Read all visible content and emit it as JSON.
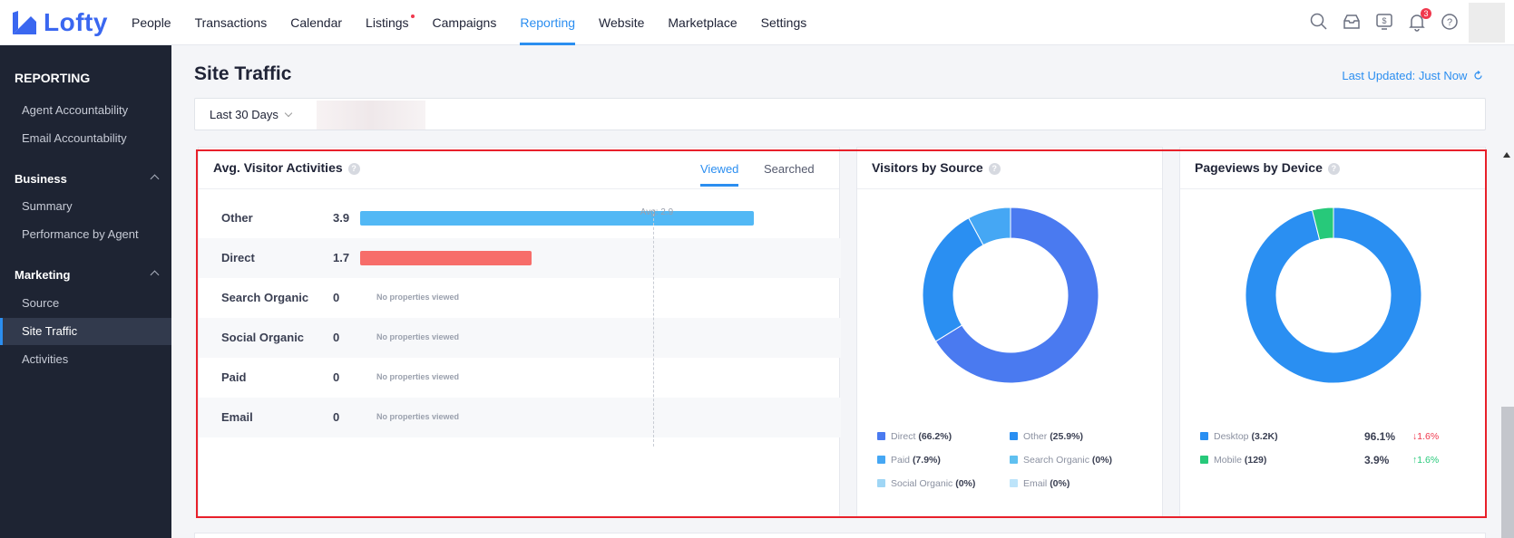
{
  "app": {
    "logo_text": "Lofty"
  },
  "nav": {
    "items": [
      "People",
      "Transactions",
      "Calendar",
      "Listings",
      "Campaigns",
      "Reporting",
      "Website",
      "Marketplace",
      "Settings"
    ],
    "active": "Reporting",
    "dot_on": "Listings",
    "notification_count": "3"
  },
  "sidebar": {
    "header": "REPORTING",
    "top_items": [
      "Agent Accountability",
      "Email Accountability"
    ],
    "business": {
      "label": "Business",
      "items": [
        "Summary",
        "Performance by Agent"
      ]
    },
    "marketing": {
      "label": "Marketing",
      "items": [
        "Source",
        "Site Traffic",
        "Activities"
      ]
    },
    "active": "Site Traffic"
  },
  "page": {
    "title": "Site Traffic",
    "last_updated": "Last Updated: Just Now",
    "date_range": "Last 30 Days"
  },
  "activities": {
    "title": "Avg. Visitor Activities",
    "tabs": [
      "Viewed",
      "Searched"
    ],
    "active_tab": "Viewed",
    "avg_label": "Avg: 2.9",
    "avg": 2.9,
    "max": 3.9,
    "empty_text": "No properties viewed",
    "rows": [
      {
        "label": "Other",
        "value": "3.9",
        "num": 3.9,
        "color": "#52b8f5"
      },
      {
        "label": "Direct",
        "value": "1.7",
        "num": 1.7,
        "color": "#f76d6a"
      },
      {
        "label": "Search Organic",
        "value": "0",
        "num": 0,
        "color": ""
      },
      {
        "label": "Social Organic",
        "value": "0",
        "num": 0,
        "color": ""
      },
      {
        "label": "Paid",
        "value": "0",
        "num": 0,
        "color": ""
      },
      {
        "label": "Email",
        "value": "0",
        "num": 0,
        "color": ""
      }
    ]
  },
  "sources": {
    "title": "Visitors by Source",
    "legend": [
      {
        "name": "Direct",
        "pct": "(66.2%)",
        "value": 66.2,
        "color": "#4a7af0"
      },
      {
        "name": "Other",
        "pct": "(25.9%)",
        "value": 25.9,
        "color": "#2a8ff2"
      },
      {
        "name": "Paid",
        "pct": "(7.9%)",
        "value": 7.9,
        "color": "#45a7f4"
      },
      {
        "name": "Search Organic",
        "pct": "(0%)",
        "value": 0,
        "color": "#5fc0f0"
      },
      {
        "name": "Social Organic",
        "pct": "(0%)",
        "value": 0,
        "color": "#9fd6f5"
      },
      {
        "name": "Email",
        "pct": "(0%)",
        "value": 0,
        "color": "#bde4fa"
      }
    ]
  },
  "devices": {
    "title": "Pageviews by Device",
    "items": [
      {
        "name": "Desktop",
        "count": "(3.2K)",
        "pct": "96.1%",
        "value": 96.1,
        "change": "1.6%",
        "direction": "down",
        "color": "#2a8ff2"
      },
      {
        "name": "Mobile",
        "count": "(129)",
        "pct": "3.9%",
        "value": 3.9,
        "change": "1.6%",
        "direction": "up",
        "color": "#27c97a"
      }
    ]
  }
}
